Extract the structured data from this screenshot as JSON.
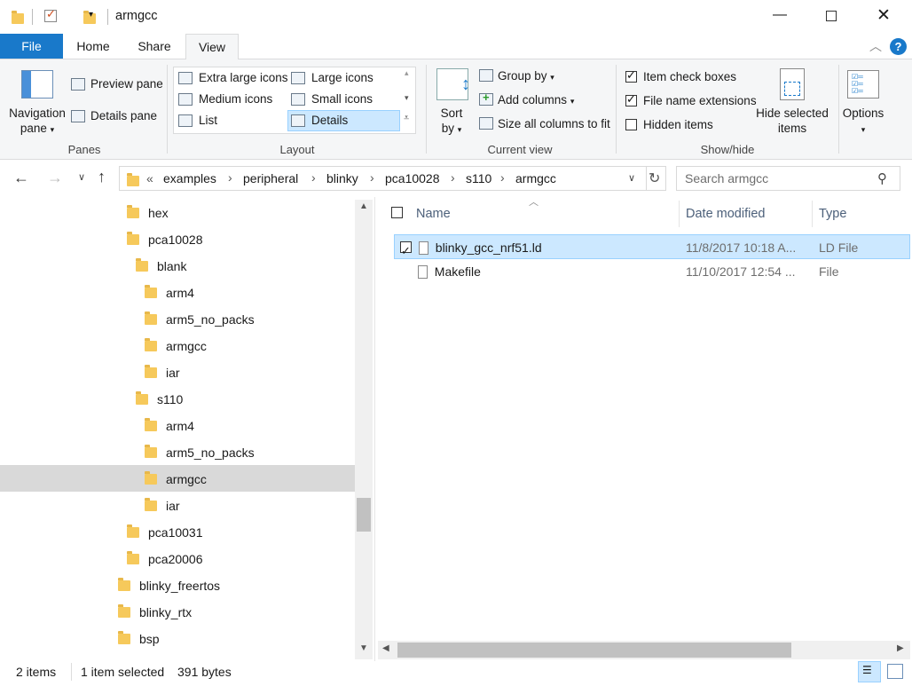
{
  "window": {
    "title": "armgcc"
  },
  "ribbon_tabs": [
    {
      "label": "File"
    },
    {
      "label": "Home"
    },
    {
      "label": "Share"
    },
    {
      "label": "View"
    }
  ],
  "panes": {
    "navigation_pane": "Navigation pane",
    "preview_pane": "Preview pane",
    "details_pane": "Details pane",
    "group_label": "Panes"
  },
  "layout": {
    "extra_large": "Extra large icons",
    "large": "Large icons",
    "medium": "Medium icons",
    "small": "Small icons",
    "list": "List",
    "details": "Details",
    "group_label": "Layout"
  },
  "current_view": {
    "sort_by": "Sort by",
    "group_by": "Group by",
    "add_columns": "Add columns",
    "size_all": "Size all columns to fit",
    "group_label": "Current view"
  },
  "show_hide": {
    "item_check_boxes": "Item check boxes",
    "file_name_extensions": "File name extensions",
    "hidden_items": "Hidden items",
    "hide_selected": "Hide selected items",
    "group_label": "Show/hide",
    "item_check_boxes_checked": true,
    "file_name_extensions_checked": true,
    "hidden_items_checked": false
  },
  "options": {
    "label": "Options"
  },
  "address": {
    "overflow": "«",
    "crumbs": [
      "examples",
      "peripheral",
      "blinky",
      "pca10028",
      "s110",
      "armgcc"
    ],
    "search_placeholder": "Search armgcc"
  },
  "tree": [
    {
      "label": "hex"
    },
    {
      "label": "pca10028"
    },
    {
      "label": "blank"
    },
    {
      "label": "arm4"
    },
    {
      "label": "arm5_no_packs"
    },
    {
      "label": "armgcc"
    },
    {
      "label": "iar"
    },
    {
      "label": "s110"
    },
    {
      "label": "arm4"
    },
    {
      "label": "arm5_no_packs"
    },
    {
      "label": "armgcc"
    },
    {
      "label": "iar"
    },
    {
      "label": "pca10031"
    },
    {
      "label": "pca20006"
    },
    {
      "label": "blinky_freertos"
    },
    {
      "label": "blinky_rtx"
    },
    {
      "label": "bsp"
    }
  ],
  "columns": {
    "name": "Name",
    "date": "Date modified",
    "type": "Type"
  },
  "files": [
    {
      "name": "blinky_gcc_nrf51.ld",
      "date": "11/8/2017 10:18 A...",
      "type": "LD File",
      "selected": true
    },
    {
      "name": "Makefile",
      "date": "11/10/2017 12:54 ...",
      "type": "File",
      "selected": false
    }
  ],
  "status": {
    "items": "2 items",
    "selected": "1 item selected",
    "size": "391 bytes"
  },
  "colors": {
    "file_tab": "#1979ca",
    "selection": "#cce8ff",
    "tree_selected": "#d9d9d9"
  }
}
